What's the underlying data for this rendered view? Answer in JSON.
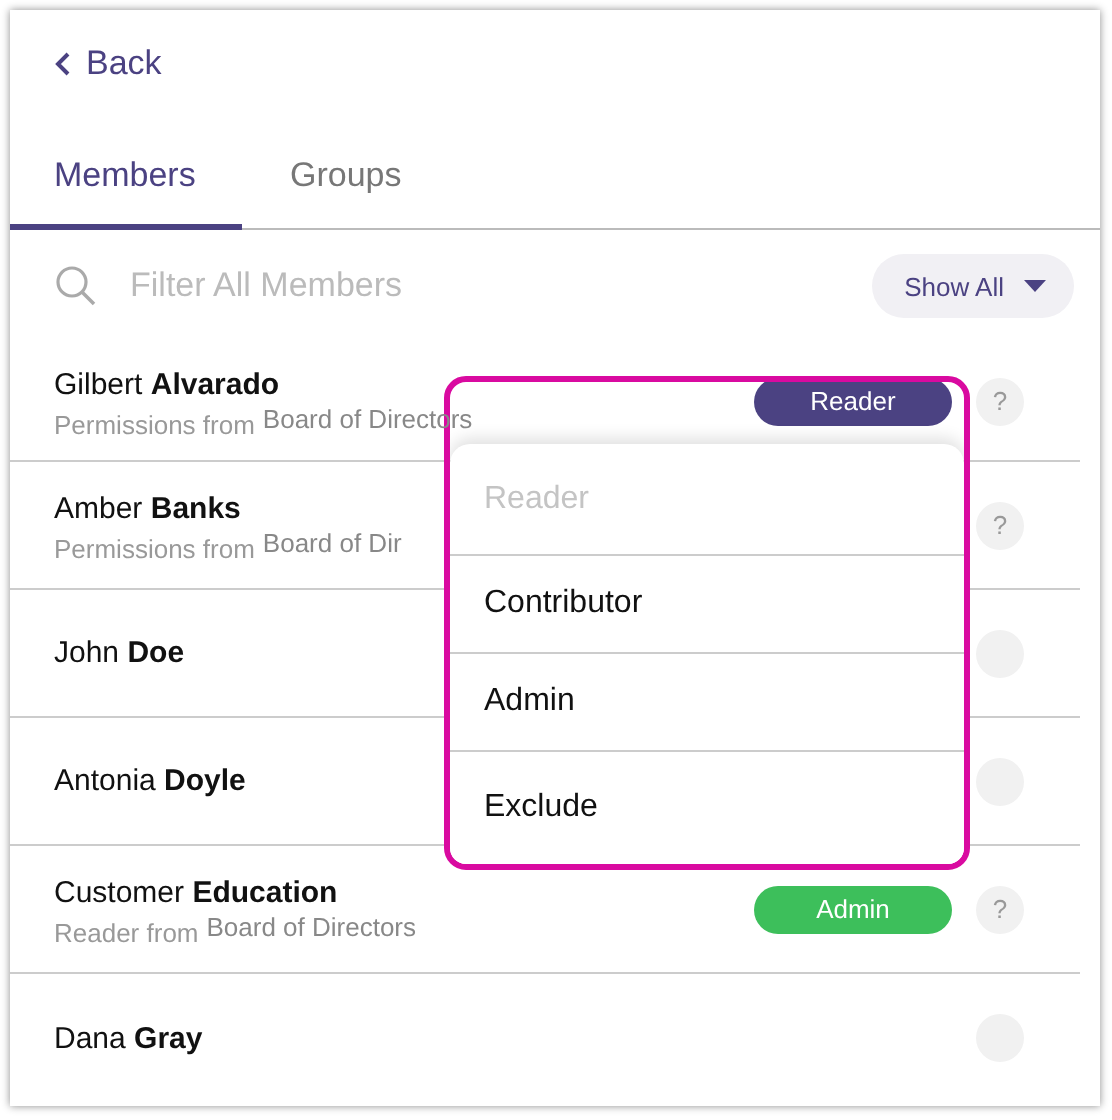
{
  "back": {
    "label": "Back"
  },
  "tabs": [
    {
      "label": "Members",
      "selected": true
    },
    {
      "label": "Groups",
      "selected": false
    }
  ],
  "filter": {
    "placeholder": "Filter All Members",
    "button": "Show All"
  },
  "members": [
    {
      "name": "Gilbert **Alvarado**",
      "source_label": "Permissions from",
      "source": "Board of Directors",
      "role": {
        "label": "Reader",
        "color": "#4b4282"
      },
      "help": "?"
    },
    {
      "name": "Amber **Banks**",
      "source_label": "Permissions from",
      "source": "Board of Dir",
      "help": "?"
    },
    {
      "name": "John **Doe**"
    },
    {
      "name": "Antonia **Doyle**"
    },
    {
      "name": "Customer **Education**",
      "source_label": "Reader from",
      "source": "Board of Directors",
      "role": {
        "label": "Admin",
        "color": "#3dbf5b"
      },
      "help": "?"
    },
    {
      "name": "Dana **Gray**"
    }
  ],
  "role_menu": {
    "options": [
      {
        "label": "Reader",
        "disabled": true
      },
      {
        "label": "Contributor",
        "disabled": false
      },
      {
        "label": "Admin",
        "disabled": false
      },
      {
        "label": "Exclude",
        "disabled": false
      }
    ]
  }
}
